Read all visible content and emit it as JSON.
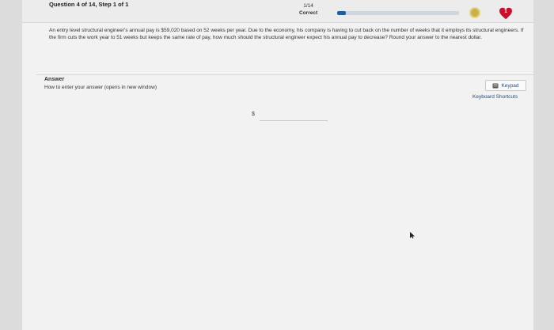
{
  "header": {
    "question_title": "Question 4 of 14, Step 1 of 1",
    "score_fraction": "1/14",
    "score_status": "Correct",
    "progress_fraction": 0.07,
    "heart_count": "1"
  },
  "question": {
    "text": "An entry level structural engineer's annual pay is $59,020 based on 52 weeks per year. Due to the economy, his company is having to cut back on the number of weeks that it employs its structural engineers. If the firm cuts the work year to 51 weeks but keeps the same rate of pay, how much should the structural engineer expect his annual pay to decrease? Round your answer to the nearest dollar."
  },
  "answer": {
    "label": "Answer",
    "help_link": "How to enter your answer (opens in new window)",
    "keypad_label": "Keypad",
    "keyboard_shortcuts": "Keyboard Shortcuts",
    "currency_symbol": "$",
    "input_value": ""
  },
  "colors": {
    "accent": "#1f5f9e",
    "heart": "#c8102e",
    "link": "#1d4f80"
  },
  "icons": [
    "coin-icon",
    "heart-icon",
    "keypad-icon",
    "cursor-icon"
  ]
}
